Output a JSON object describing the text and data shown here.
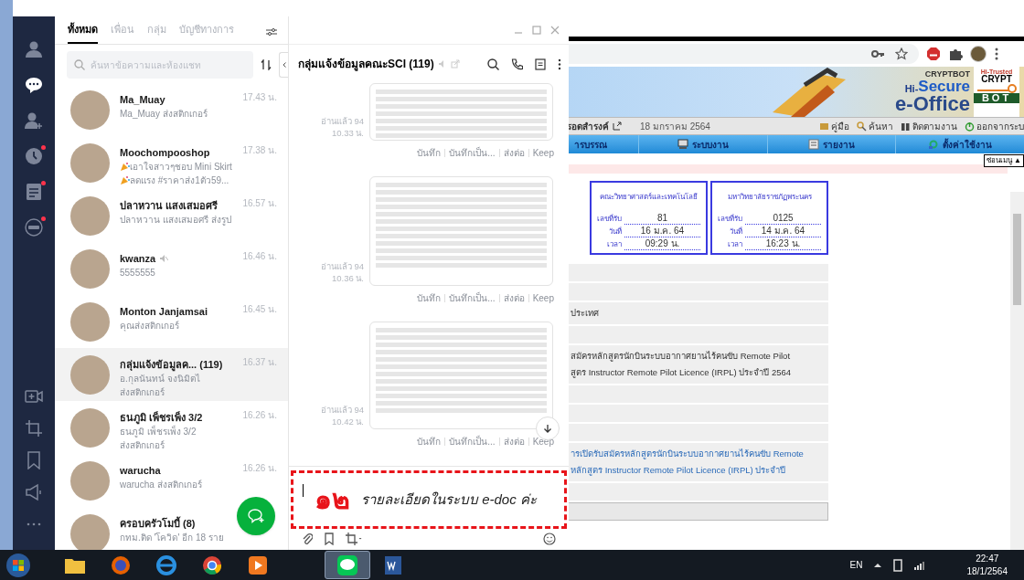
{
  "line_app": {
    "rail": {
      "top": [
        {
          "selected": false,
          "notification": false
        },
        {
          "selected": true,
          "notification": false
        },
        {
          "selected": false,
          "notification": false
        },
        {
          "selected": false,
          "notification": true
        },
        {
          "selected": false,
          "notification": true
        },
        {
          "selected": false,
          "notification": true
        }
      ],
      "bottom": [
        {
          "selected": false,
          "notification": false
        },
        {
          "selected": false,
          "notification": false
        },
        {
          "selected": false,
          "notification": false
        },
        {
          "selected": false,
          "notification": false
        },
        {
          "selected": false,
          "notification": false
        }
      ]
    },
    "tabs": [
      {
        "label": "ทั้งหมด",
        "selected": true
      },
      {
        "label": "เพื่อน",
        "selected": false
      },
      {
        "label": "กลุ่ม",
        "selected": false
      },
      {
        "label": "บัญชีทางการ",
        "selected": false
      }
    ],
    "search": {
      "placeholder": "ค้นหาข้อความและห้องแชท"
    },
    "chats": [
      {
        "name": "Ma_Muay",
        "preview": [
          {
            "text": "Ma_Muay ส่งสติกเกอร์",
            "kind": "plain"
          }
        ],
        "time": "17.43 น.",
        "muted": false,
        "selected": false
      },
      {
        "name": "Moochompooshop",
        "preview": [
          {
            "text": "เอาใจสาวๆชอบ Mini Skirt",
            "kind": "party"
          },
          {
            "text": "ลดแรง #ราคาส่ง1ตัว59...",
            "kind": "party"
          }
        ],
        "time": "17.38 น.",
        "muted": false,
        "selected": false
      },
      {
        "name": "ปลาหวาน แสงเสมอศรี",
        "preview": [
          {
            "text": "ปลาหวาน แสงเสมอศรี ส่งรูป",
            "kind": "plain"
          }
        ],
        "time": "16.57 น.",
        "muted": false,
        "selected": false
      },
      {
        "name": "kwanza",
        "preview": [
          {
            "text": "5555555",
            "kind": "plain"
          }
        ],
        "time": "16.46 น.",
        "muted": true,
        "selected": false
      },
      {
        "name": "Monton Janjamsai",
        "preview": [
          {
            "text": "คุณส่งสติกเกอร์",
            "kind": "plain"
          }
        ],
        "time": "16.45 น.",
        "muted": false,
        "selected": false
      },
      {
        "name": "กลุ่มแจ้งข้อมูลค... (119)",
        "preview": [
          {
            "text": "อ.กุลนันทน์ จงนิมิตไ",
            "kind": "plain"
          },
          {
            "text": "ส่งสติกเกอร์",
            "kind": "plain"
          }
        ],
        "time": "16.37 น.",
        "muted": false,
        "selected": true
      },
      {
        "name": "ธนภูมิ เพ็ชรเพ็ง 3/2",
        "preview": [
          {
            "text": "ธนภูมิ เพ็ชรเพ็ง 3/2",
            "kind": "plain"
          },
          {
            "text": "ส่งสติกเกอร์",
            "kind": "plain"
          }
        ],
        "time": "16.26 น.",
        "muted": false,
        "selected": false
      },
      {
        "name": "warucha",
        "preview": [
          {
            "text": "warucha ส่งสติกเกอร์",
            "kind": "plain"
          }
        ],
        "time": "16.26 น.",
        "muted": false,
        "selected": false
      },
      {
        "name": "ครอบครัวโมบี้ (8)",
        "preview": [
          {
            "text": "กทม.ติด 'โควิด' อีก 18 ราย",
            "kind": "plain"
          }
        ],
        "muted": false,
        "selected": false
      }
    ],
    "conversation": {
      "title": "กลุ่มแจ้งข้อมูลคณะSCI (119)",
      "messages": [
        {
          "read": "อ่านแล้ว 94",
          "time": "10.33 น.",
          "actions": [
            "บันทึก",
            "บันทึกเป็น...",
            "ส่งต่อ",
            "Keep"
          ]
        },
        {
          "read": "อ่านแล้ว 94",
          "time": "10.36 น.",
          "actions": [
            "บันทึก",
            "บันทึกเป็น...",
            "ส่งต่อ",
            "Keep"
          ]
        },
        {
          "read": "อ่านแล้ว 94",
          "time": "10.42 น.",
          "actions": [
            "บันทึก",
            "บันทึกเป็น...",
            "ส่งต่อ",
            "Keep"
          ]
        }
      ],
      "composer": {
        "number": "๑๒",
        "text": "รายละเอียดในระบบ e-doc ค่ะ"
      }
    }
  },
  "browser": {
    "banner": {
      "brand_top": "CRYPTBOT",
      "brand_prefix": "Hi-",
      "brand_main": "Secure",
      "brand_sub": "e-Office",
      "badge_top": "Hi-Trusted",
      "badge_mid": "CRYPT",
      "badge_bottom": "BOT"
    },
    "user": "รอดสำรงค์",
    "date": "18 มกราคม 2564",
    "links": [
      "คู่มือ",
      "ค้นหา",
      "ติดตามงาน",
      "ออกจากระบ"
    ],
    "menu": [
      "ารบรรณ",
      "ระบบงาน",
      "รายงาน",
      "ตั้งค่าใช้งาน"
    ],
    "hide_menu": "ซ่อนเมนู ▲",
    "stamps": [
      {
        "org": "คณะวิทยาศาสตร์และเทคโนโลยี",
        "fields": [
          {
            "label": "เลขที่รับ",
            "value": "81"
          },
          {
            "label": "วันที่",
            "value": "16 ม.ค. 64"
          },
          {
            "label": "เวลา",
            "value": "09:29 น."
          }
        ]
      },
      {
        "org": "มหาวิทยาลัยราชภัฏพระนคร",
        "fields": [
          {
            "label": "เลขที่รับ",
            "value": "0125"
          },
          {
            "label": "วันที่",
            "value": "14 ม.ค. 64"
          },
          {
            "label": "เวลา",
            "value": "16:23 น."
          }
        ]
      }
    ],
    "rows": [
      {
        "kind": "blank",
        "lines": []
      },
      {
        "kind": "blank",
        "lines": []
      },
      {
        "kind": "text",
        "lines": [
          "ประเทศ"
        ]
      },
      {
        "kind": "blank",
        "lines": []
      },
      {
        "kind": "text",
        "lines": [
          "สมัครหลักสูตรนักบินระบบอากาศยานไร้คนขับ Remote Pilot",
          "สูตร Instructor Remote Pilot Licence (IRPL) ประจำปี 2564"
        ]
      },
      {
        "kind": "blank",
        "lines": []
      },
      {
        "kind": "blank",
        "lines": []
      },
      {
        "kind": "blank",
        "lines": []
      },
      {
        "kind": "link",
        "lines": [
          "ารเปิดรับสมัครหลักสูตรนักบินระบบอากาศยานไร้คนขับ Remote",
          "หลักสูตร Instructor Remote Pilot Licence (IRPL) ประจำปี"
        ]
      },
      {
        "kind": "blank",
        "lines": []
      },
      {
        "kind": "header",
        "lines": []
      }
    ]
  },
  "taskbar": {
    "apps": [
      {
        "kind": "folder",
        "selected": false
      },
      {
        "kind": "firefox",
        "selected": false
      },
      {
        "kind": "ie",
        "selected": false
      },
      {
        "kind": "chrome",
        "selected": false
      },
      {
        "kind": "media",
        "selected": false
      },
      {
        "kind": "line",
        "selected": true
      },
      {
        "kind": "word",
        "selected": false
      }
    ],
    "language": "EN",
    "time": "22:47",
    "date": "18/1/2564"
  }
}
